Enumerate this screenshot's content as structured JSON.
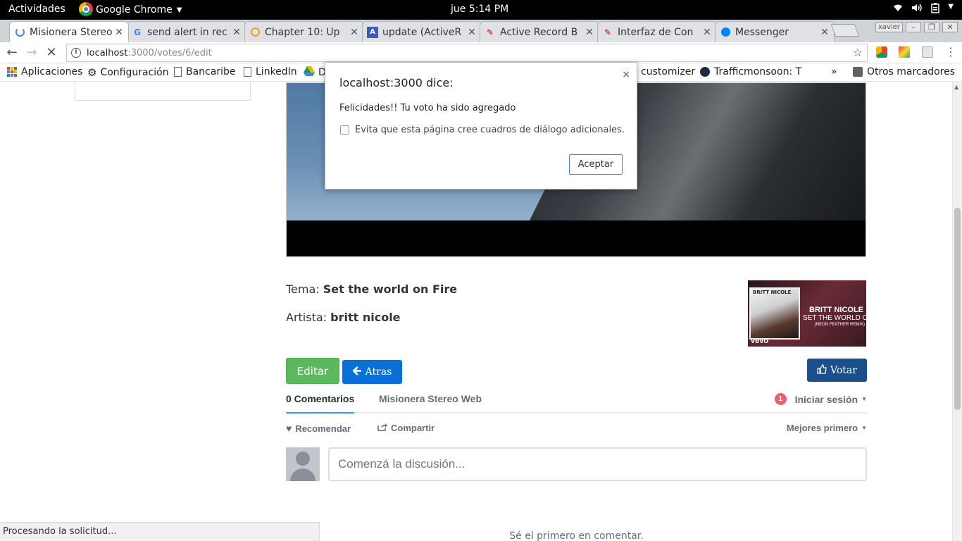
{
  "system_bar": {
    "activities": "Actividades",
    "app_name": "Google Chrome",
    "clock": "jue  5:14 PM"
  },
  "browser": {
    "tabs": [
      {
        "title": "Misionera Stereo",
        "active": true
      },
      {
        "title": "send alert in rec"
      },
      {
        "title": "Chapter 10: Up"
      },
      {
        "title": "update (ActiveR"
      },
      {
        "title": "Active Record B"
      },
      {
        "title": "Interfaz de Con"
      },
      {
        "title": "Messenger"
      }
    ],
    "profile_name": "xavier",
    "url_host": "localhost",
    "url_path": ":3000/votes/6/edit",
    "bookmarks": [
      {
        "label": "Aplicaciones"
      },
      {
        "label": "Configuración"
      },
      {
        "label": "Bancaribe"
      },
      {
        "label": "LinkedIn"
      },
      {
        "label": "D"
      },
      {
        "label": "customizer"
      },
      {
        "label": "Trafficmonsoon: T"
      },
      {
        "label": "Otros marcadores"
      }
    ],
    "status_text": "Procesando la solicitud..."
  },
  "page": {
    "tema_label": "Tema:",
    "tema_value": "Set the world on Fire",
    "artista_label": "Artista:",
    "artista_value": "britt nicole",
    "thumb": {
      "cover_text": "BRITT NICOLE",
      "artist": "BRITT NICOLE",
      "title": "SET THE WORLD ON F",
      "subtitle": "(NEON FEATHER REMIX)",
      "vevo": "vevo"
    },
    "editar_label": "Editar",
    "atras_label": "Atras",
    "votar_label": "Votar"
  },
  "disqus": {
    "comments_tab": "0 Comentarios",
    "site_tab": "Misionera Stereo Web",
    "notif_count": "1",
    "login_label": "Iniciar sesión",
    "recommend_label": "Recomendar",
    "share_label": "Compartir",
    "sort_label": "Mejores primero",
    "input_placeholder": "Comenzá la discusión...",
    "empty_text": "Sé el primero en comentar."
  },
  "dialog": {
    "title": "localhost:3000 dice:",
    "message": "Felicidades!! Tu voto ha sido agregado",
    "checkbox_label": "Evita que esta página cree cuadros de diálogo adicionales.",
    "ok_label": "Aceptar",
    "close_glyph": "×"
  },
  "colors": {
    "editar": "#5cb85c",
    "atras": "#0a70d6",
    "votar": "#1b4f8c",
    "disqus_accent": "#2e9fff",
    "badge": "#f05f70"
  }
}
